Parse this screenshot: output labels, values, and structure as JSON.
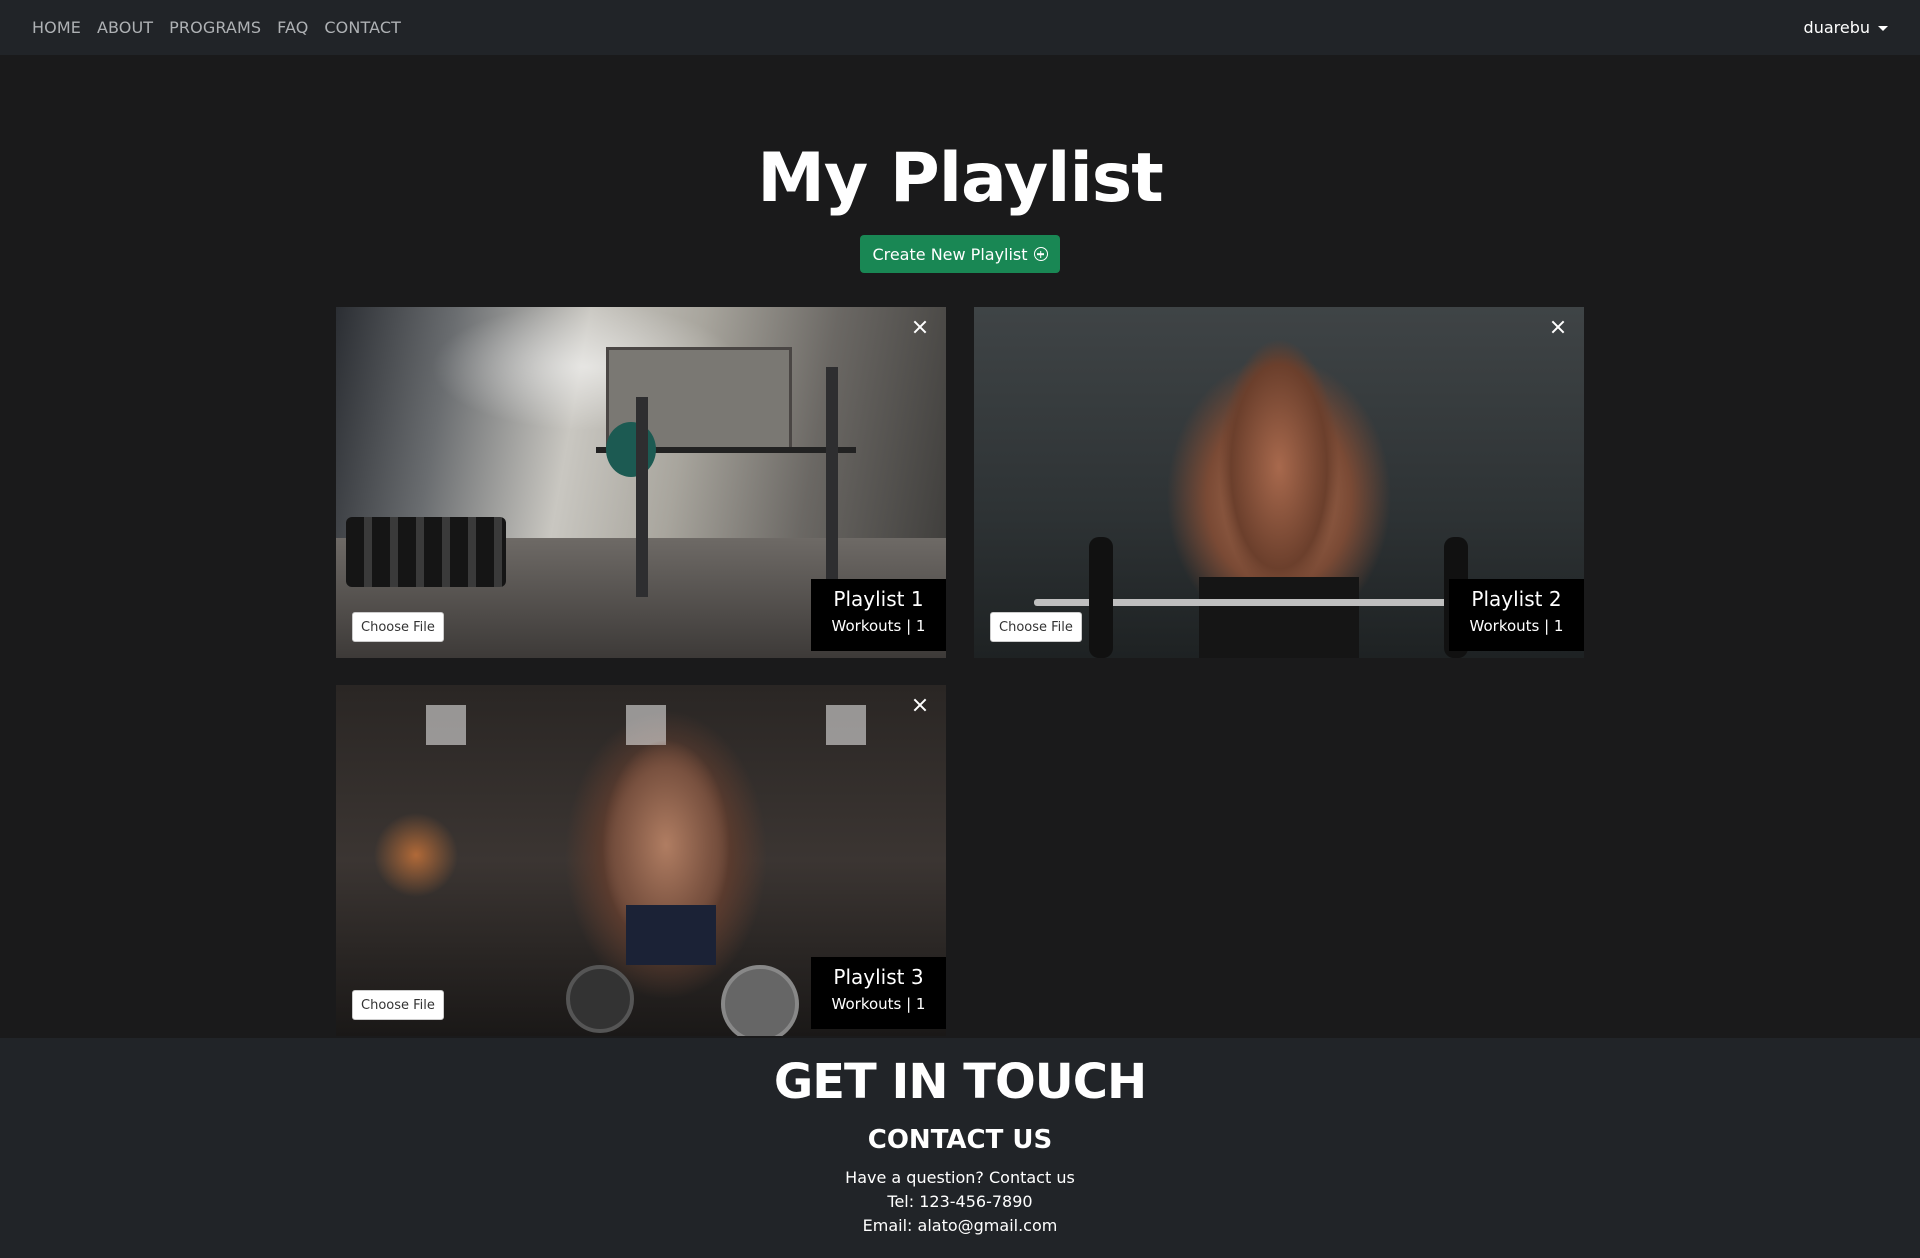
{
  "nav": {
    "links": [
      "HOME",
      "ABOUT",
      "PROGRAMS",
      "FAQ",
      "CONTACT"
    ],
    "username": "duarebu"
  },
  "page": {
    "title": "My Playlist",
    "create_button": "Create New Playlist"
  },
  "playlists": [
    {
      "name": "Playlist 1",
      "workouts": "Workouts | 1",
      "file_button": "Choose File",
      "image": "gym-interior-photo"
    },
    {
      "name": "Playlist 2",
      "workouts": "Workouts | 1",
      "file_button": "Choose File",
      "image": "bodybuilder-barbell-photo"
    },
    {
      "name": "Playlist 3",
      "workouts": "Workouts | 1",
      "file_button": "Choose File",
      "image": "bodybuilder-weights-photo"
    }
  ],
  "footer": {
    "title": "GET IN TOUCH",
    "contact_title": "CONTACT US",
    "question": "Have a question? Contact us",
    "tel": "Tel: 123-456-7890",
    "email": "Email: alato@gmail.com"
  },
  "colors": {
    "background": "#1a1a1b",
    "navbar": "#212428",
    "create_button": "#198754"
  }
}
